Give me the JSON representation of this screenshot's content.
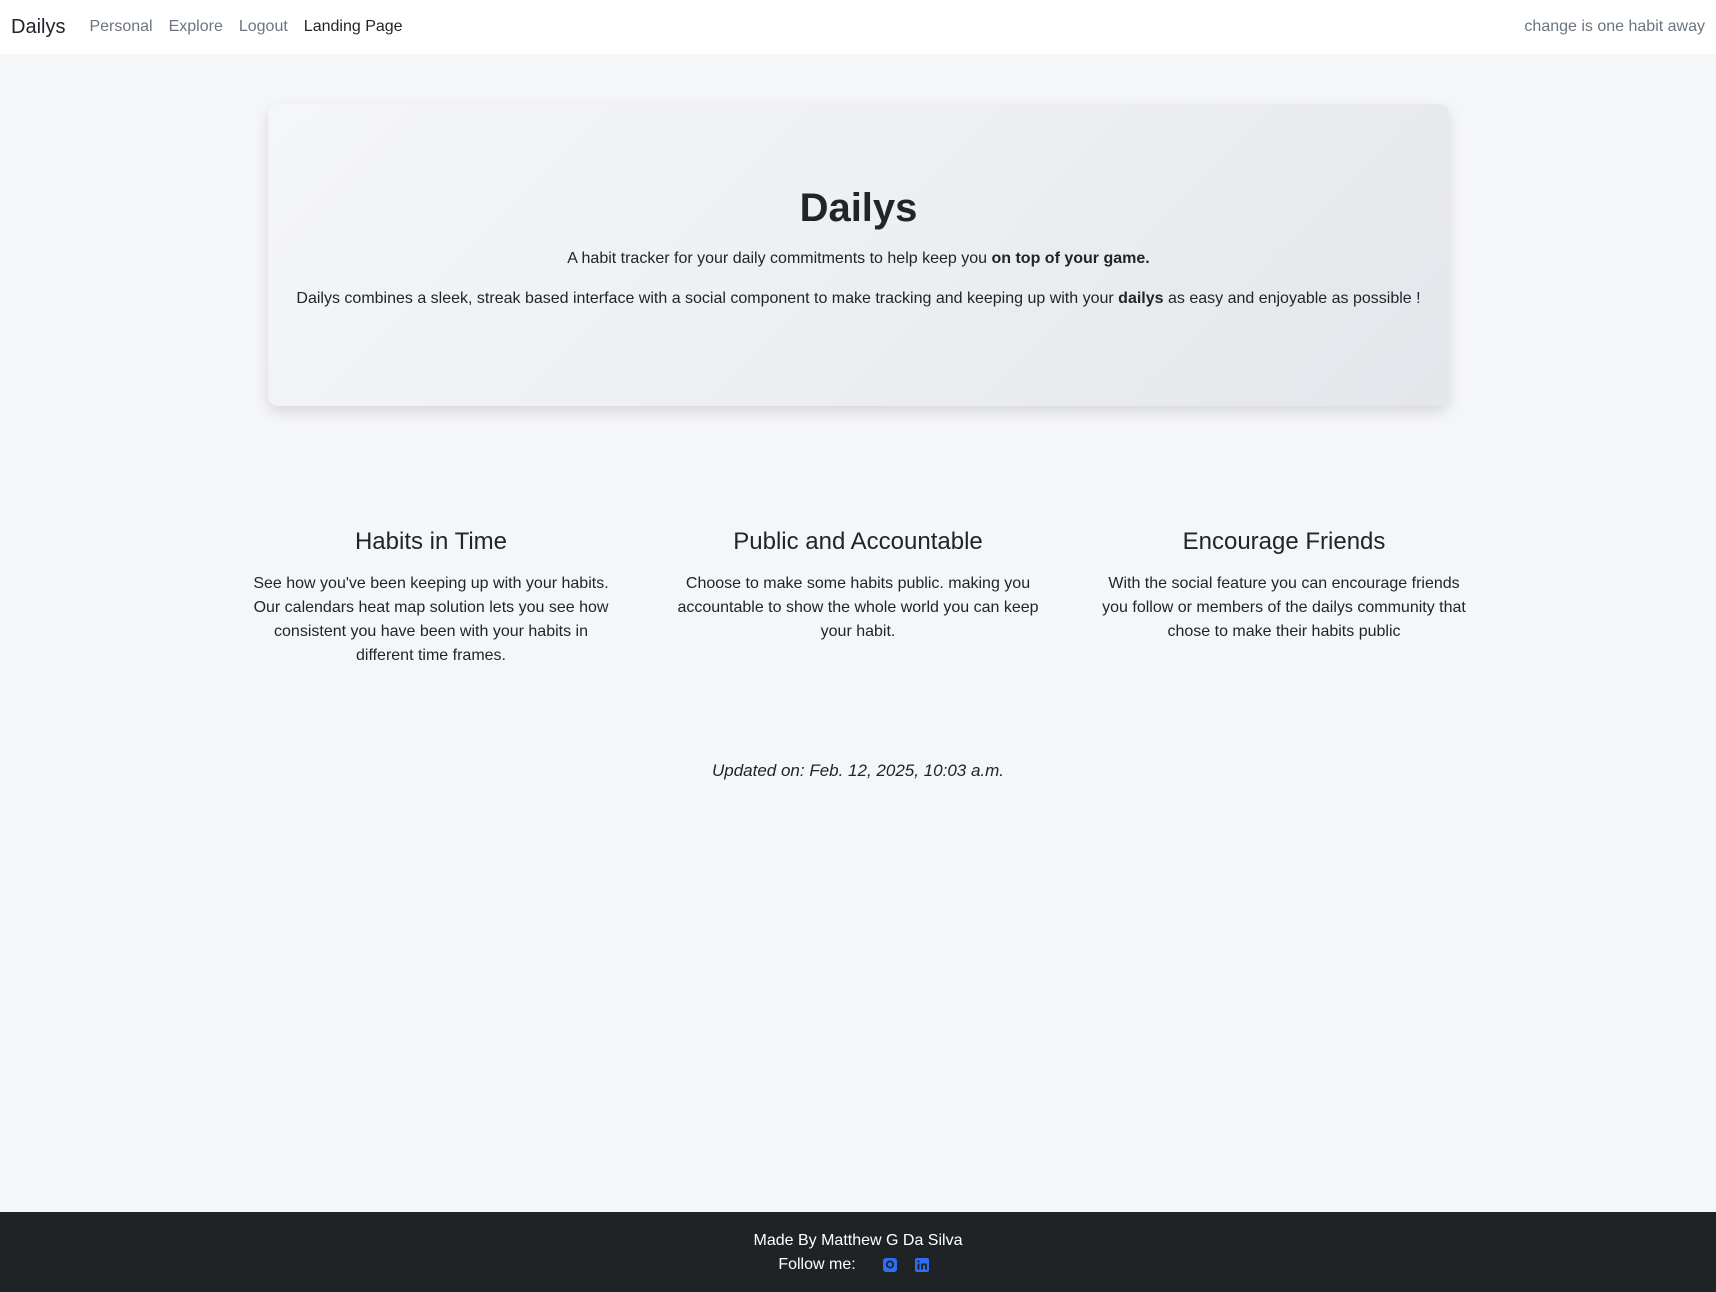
{
  "navbar": {
    "brand": "Dailys",
    "links": [
      {
        "label": "Personal",
        "active": false
      },
      {
        "label": "Explore",
        "active": false
      },
      {
        "label": "Logout",
        "active": false
      },
      {
        "label": "Landing Page",
        "active": true
      }
    ],
    "tagline": "change is one habit away"
  },
  "hero": {
    "title": "Dailys",
    "subtitle_pre": "A habit tracker for your daily commitments to help keep you ",
    "subtitle_bold": "on top of your game.",
    "desc_pre": "Dailys combines a sleek, streak based interface with a social component to make tracking and keeping up with your ",
    "desc_bold": "dailys",
    "desc_post": " as easy and enjoyable as possible !"
  },
  "features": [
    {
      "title": "Habits in Time",
      "lines": [
        "See how you've been keeping up with your habits.",
        "Our calendars heat map solution lets you see how",
        "consistent you have been with your habits in",
        "different time frames."
      ]
    },
    {
      "title": "Public and Accountable",
      "lines": [
        "Choose to make some habits public. making you",
        "accountable to show the whole world you can keep",
        "your habit."
      ]
    },
    {
      "title": "Encourage Friends",
      "lines": [
        "With the social feature you can encourage friends",
        "you follow or members of the dailys community that",
        "chose to make their habits public"
      ]
    }
  ],
  "updated": "Updated on: Feb. 12, 2025, 10:03 a.m.",
  "footer": {
    "made_by": "Made By Matthew G Da Silva",
    "follow_label": "Follow me:",
    "icons": [
      "github-icon",
      "linkedin-icon"
    ]
  },
  "colors": {
    "background": "#f5f6f8",
    "footer_bg": "#1f2326",
    "social_icon": "#2f6df5",
    "nav_muted": "#6c757d"
  }
}
